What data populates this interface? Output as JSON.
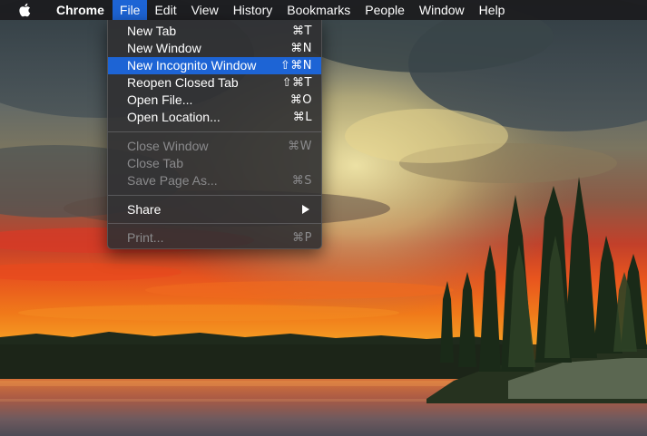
{
  "menubar": {
    "apple_icon": "apple-logo-icon",
    "app_name": "Chrome",
    "items": [
      {
        "label": "File",
        "active": true
      },
      {
        "label": "Edit"
      },
      {
        "label": "View"
      },
      {
        "label": "History"
      },
      {
        "label": "Bookmarks"
      },
      {
        "label": "People"
      },
      {
        "label": "Window"
      },
      {
        "label": "Help"
      }
    ]
  },
  "file_menu": {
    "items": [
      {
        "label": "New Tab",
        "shortcut": "⌘T",
        "enabled": true
      },
      {
        "label": "New Window",
        "shortcut": "⌘N",
        "enabled": true
      },
      {
        "label": "New Incognito Window",
        "shortcut": "⇧⌘N",
        "enabled": true,
        "highlighted": true
      },
      {
        "label": "Reopen Closed Tab",
        "shortcut": "⇧⌘T",
        "enabled": true
      },
      {
        "label": "Open File...",
        "shortcut": "⌘O",
        "enabled": true
      },
      {
        "label": "Open Location...",
        "shortcut": "⌘L",
        "enabled": true
      },
      {
        "label": "Close Window",
        "shortcut": "⌘W",
        "enabled": false
      },
      {
        "label": "Close Tab",
        "shortcut": "",
        "enabled": false
      },
      {
        "label": "Save Page As...",
        "shortcut": "⌘S",
        "enabled": false
      },
      {
        "label": "Share",
        "submenu": true,
        "enabled": true
      },
      {
        "label": "Print...",
        "shortcut": "⌘P",
        "enabled": false
      }
    ]
  },
  "colors": {
    "highlight": "#1d64d5",
    "menubar_bg": "#1c1c1e",
    "disabled_text": "#8a8a8c"
  }
}
